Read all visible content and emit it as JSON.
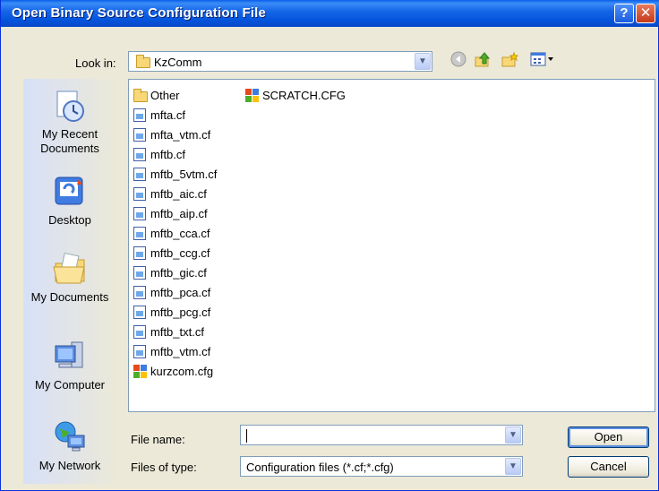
{
  "window": {
    "title": "Open Binary Source Configuration File"
  },
  "titlebar": {
    "help_glyph": "?",
    "close_glyph": "✕"
  },
  "lookin": {
    "label": "Look in:",
    "value": "KzComm"
  },
  "places": [
    {
      "label": "My Recent Documents",
      "icon": "recent-documents-icon"
    },
    {
      "label": "Desktop",
      "icon": "desktop-icon"
    },
    {
      "label": "My Documents",
      "icon": "my-documents-icon"
    },
    {
      "label": "My Computer",
      "icon": "my-computer-icon"
    },
    {
      "label": "My Network",
      "icon": "my-network-icon"
    }
  ],
  "files_col1": [
    {
      "name": "Other",
      "type": "folder"
    },
    {
      "name": "mfta.cf",
      "type": "cf"
    },
    {
      "name": "mfta_vtm.cf",
      "type": "cf"
    },
    {
      "name": "mftb.cf",
      "type": "cf"
    },
    {
      "name": "mftb_5vtm.cf",
      "type": "cf"
    },
    {
      "name": "mftb_aic.cf",
      "type": "cf"
    },
    {
      "name": "mftb_aip.cf",
      "type": "cf"
    },
    {
      "name": "mftb_cca.cf",
      "type": "cf"
    },
    {
      "name": "mftb_ccg.cf",
      "type": "cf"
    },
    {
      "name": "mftb_gic.cf",
      "type": "cf"
    },
    {
      "name": "mftb_pca.cf",
      "type": "cf"
    },
    {
      "name": "mftb_pcg.cf",
      "type": "cf"
    },
    {
      "name": "mftb_txt.cf",
      "type": "cf"
    },
    {
      "name": "mftb_vtm.cf",
      "type": "cf"
    },
    {
      "name": "kurzcom.cfg",
      "type": "cfg"
    }
  ],
  "files_col2": [
    {
      "name": "SCRATCH.CFG",
      "type": "cfg"
    }
  ],
  "filename": {
    "label": "File name:",
    "value": ""
  },
  "filetype": {
    "label": "Files of type:",
    "value": "Configuration files (*.cf;*.cfg)"
  },
  "buttons": {
    "open": "Open",
    "cancel": "Cancel"
  },
  "colors": {
    "title_bar": "#0554dc",
    "window_bg": "#ece9d8",
    "field_border": "#7f9db9"
  }
}
